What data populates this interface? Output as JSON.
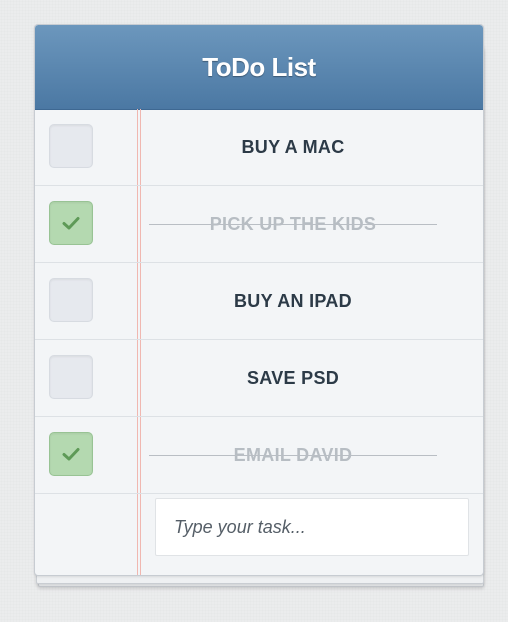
{
  "header": {
    "title": "ToDo List"
  },
  "tasks": [
    {
      "label": "BUY A MAC",
      "done": false
    },
    {
      "label": "PICK UP THE KIDS",
      "done": true
    },
    {
      "label": "BUY AN IPAD",
      "done": false
    },
    {
      "label": "SAVE PSD",
      "done": false
    },
    {
      "label": "EMAIL DAVID",
      "done": true
    }
  ],
  "new_task": {
    "placeholder": "Type your task...",
    "value": ""
  },
  "colors": {
    "header": "#5a86b0",
    "checked": "#b4d9b0",
    "check_mark": "#5e9a57",
    "margin_line": "#f0b7b0"
  },
  "icons": {
    "check": "checkmark-icon"
  }
}
